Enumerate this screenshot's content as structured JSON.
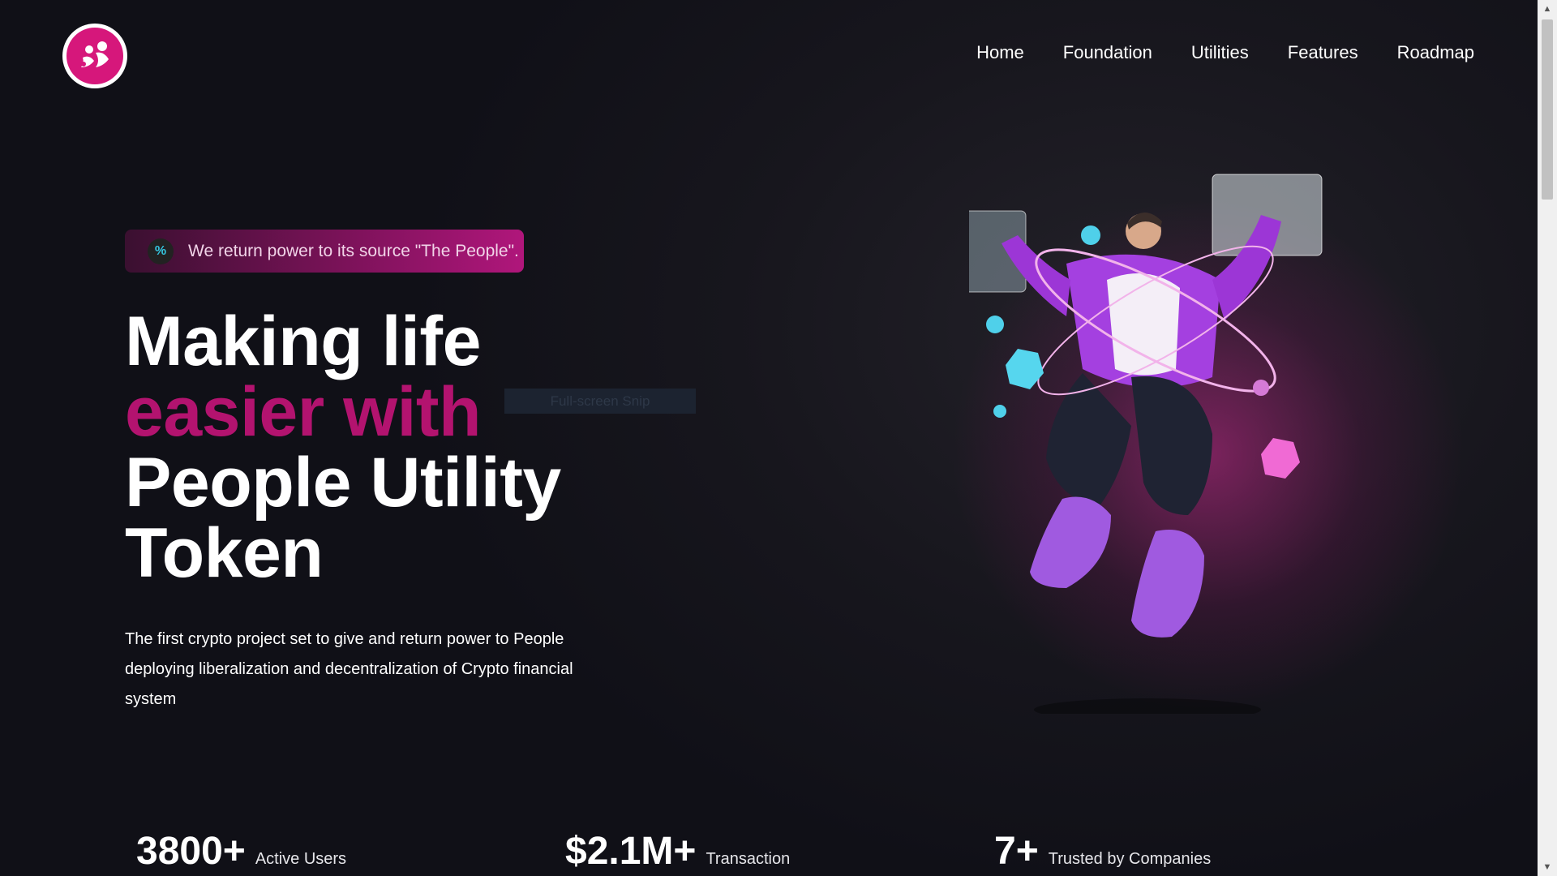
{
  "nav": {
    "items": [
      "Home",
      "Foundation",
      "Utilities",
      "Features",
      "Roadmap"
    ]
  },
  "badge": {
    "icon": "percent-icon",
    "text": "We return power to its source \"The People\"."
  },
  "hero": {
    "title_line1": "Making life",
    "title_line2": "easier with",
    "title_line3": "People Utility",
    "title_line4": "Token",
    "description": "The first crypto project set to give and return power to People deploying liberalization and decentralization of Crypto financial system"
  },
  "snip_overlay": "Full-screen Snip",
  "stats": [
    {
      "value": "3800+",
      "label": "Active Users"
    },
    {
      "value": "$2.1M+",
      "label": "Transaction"
    },
    {
      "value": "7+",
      "label": "Trusted by Companies"
    }
  ],
  "colors": {
    "accent": "#b3136f",
    "background": "#111118",
    "badge_end": "#b0167b",
    "glow": "#c8288c"
  }
}
